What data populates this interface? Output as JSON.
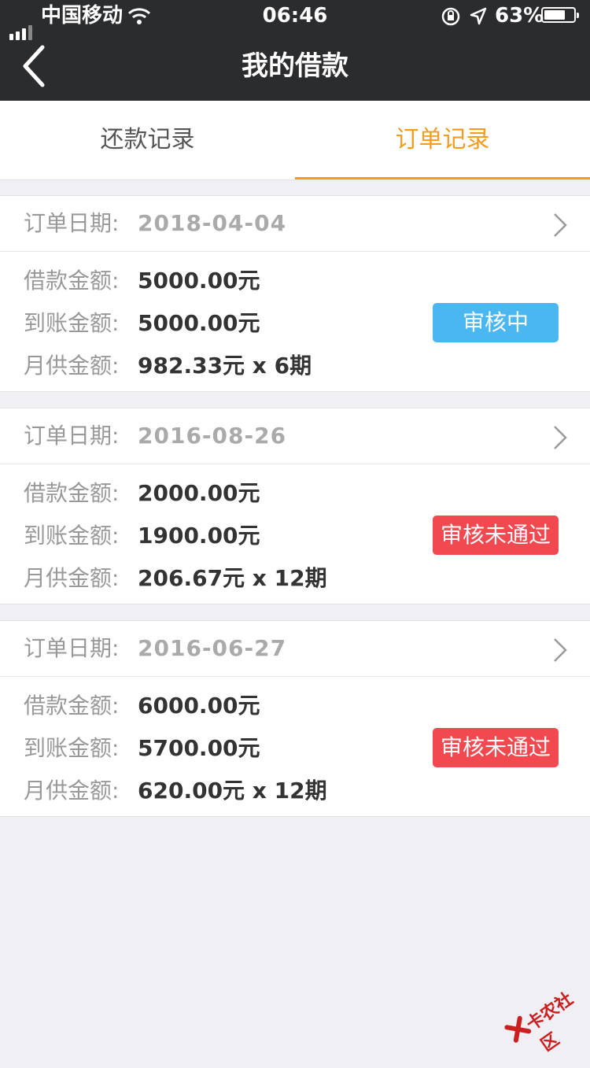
{
  "status_bar": {
    "carrier": "中国移动",
    "time": "06:46",
    "battery_pct": "63%"
  },
  "nav": {
    "title": "我的借款"
  },
  "tabs": [
    {
      "label": "还款记录",
      "active": false
    },
    {
      "label": "订单记录",
      "active": true
    }
  ],
  "colors": {
    "accent": "#f39c1f",
    "status_reviewing": "#4ab7f0",
    "status_rejected": "#f2484f",
    "header_bg": "#2b2c2e"
  },
  "orders": [
    {
      "date_label": "订单日期:",
      "date": "2018-04-04",
      "rows": [
        {
          "label": "借款金额:",
          "value": "5000.00元"
        },
        {
          "label": "到账金额:",
          "value": "5000.00元"
        },
        {
          "label": "月供金额:",
          "value": "982.33元 x 6期"
        }
      ],
      "status": "审核中"
    },
    {
      "date_label": "订单日期:",
      "date": "2016-08-26",
      "rows": [
        {
          "label": "借款金额:",
          "value": "2000.00元"
        },
        {
          "label": "到账金额:",
          "value": "1900.00元"
        },
        {
          "label": "月供金额:",
          "value": "206.67元 x 12期"
        }
      ],
      "status": "审核未通过"
    },
    {
      "date_label": "订单日期:",
      "date": "2016-06-27",
      "rows": [
        {
          "label": "借款金额:",
          "value": "6000.00元"
        },
        {
          "label": "到账金额:",
          "value": "5700.00元"
        },
        {
          "label": "月供金额:",
          "value": "620.00元 x 12期"
        }
      ],
      "status": "审核未通过"
    }
  ],
  "watermark": {
    "text": "卡农社区"
  }
}
